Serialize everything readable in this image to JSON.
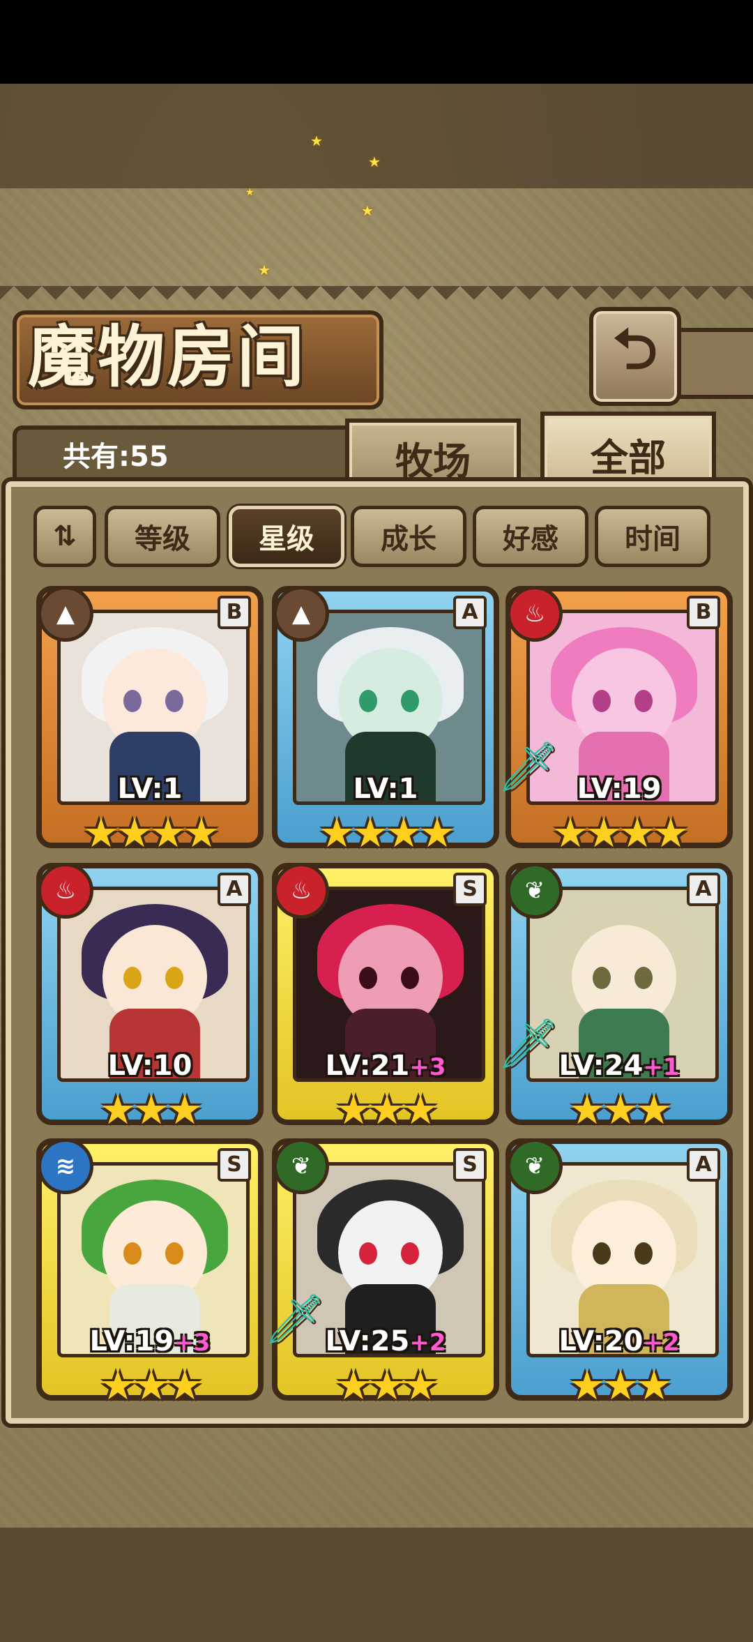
{
  "title": "魔物房间",
  "count_label": "共有:55",
  "tabs": [
    {
      "label": "牧场",
      "active": false
    },
    {
      "label": "全部",
      "active": true
    }
  ],
  "sort_buttons": [
    {
      "label": "等级",
      "active": false
    },
    {
      "label": "星级",
      "active": true
    },
    {
      "label": "成长",
      "active": false
    },
    {
      "label": "好感",
      "active": false
    },
    {
      "label": "时间",
      "active": false
    }
  ],
  "icons": {
    "back": "back-arrow-icon",
    "sort_order": "sort-order-icon",
    "element_earth": "earth-element-icon",
    "element_fire": "fire-element-icon",
    "element_wood": "leaf-element-icon",
    "element_water": "water-element-icon",
    "equipment": "sword-icon",
    "star": "star-icon"
  },
  "colors": {
    "rank_B": "#f2a14a",
    "rank_A": "#8fd3f0",
    "rank_S": "#fff067",
    "plus_level": "#ff5ad2"
  },
  "monsters": [
    {
      "rank": "B",
      "element": "earth",
      "level": "LV:1",
      "plus": "",
      "stars": "★★★★",
      "star_count": 4,
      "equipped": false
    },
    {
      "rank": "A",
      "element": "earth",
      "level": "LV:1",
      "plus": "",
      "stars": "★★★★",
      "star_count": 4,
      "equipped": false
    },
    {
      "rank": "B",
      "element": "fire",
      "level": "LV:19",
      "plus": "",
      "stars": "★★★★",
      "star_count": 4,
      "equipped": true
    },
    {
      "rank": "A",
      "element": "fire",
      "level": "LV:10",
      "plus": "",
      "stars": "★★★",
      "star_count": 3,
      "equipped": false
    },
    {
      "rank": "S",
      "element": "fire",
      "level": "LV:21",
      "plus": "+3",
      "stars": "★★★",
      "star_count": 3,
      "equipped": false
    },
    {
      "rank": "A",
      "element": "wood",
      "level": "LV:24",
      "plus": "+1",
      "stars": "★★★",
      "star_count": 3,
      "equipped": true
    },
    {
      "rank": "S",
      "element": "water",
      "level": "LV:19",
      "plus": "+3",
      "stars": "★★★",
      "star_count": 3,
      "equipped": false
    },
    {
      "rank": "S",
      "element": "wood",
      "level": "LV:25",
      "plus": "+2",
      "stars": "★★★",
      "star_count": 3,
      "equipped": true
    },
    {
      "rank": "A",
      "element": "wood",
      "level": "LV:20",
      "plus": "+2",
      "stars": "★★★",
      "star_count": 3,
      "equipped": false
    }
  ]
}
